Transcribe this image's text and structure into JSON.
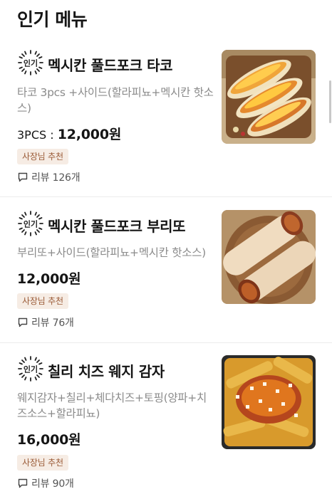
{
  "section": {
    "title": "인기 메뉴"
  },
  "popular_badge": {
    "label": "인기"
  },
  "items": [
    {
      "name": "멕시칸 풀드포크 타코",
      "description": "타코 3pcs +사이드(할라피뇨+멕시칸 핫소스)",
      "qty_label": "3PCS : ",
      "price": "12,000원",
      "owner_tag": "사장님 추천",
      "review": "리뷰 126개",
      "image_icon": "taco-photo"
    },
    {
      "name": "멕시칸 풀드포크 부리또",
      "description": "부리또+사이드(할라피뇨+멕시칸 핫소스)",
      "qty_label": "",
      "price": "12,000원",
      "owner_tag": "사장님 추천",
      "review": "리뷰 76개",
      "image_icon": "burrito-photo"
    },
    {
      "name": "칠리 치즈 웨지 감자",
      "description": "웨지감자+칠리+체다치즈+토핑(양파+치즈소스+할라피뇨)",
      "qty_label": "",
      "price": "16,000원",
      "owner_tag": "사장님 추천",
      "review": "리뷰 90개",
      "image_icon": "chili-cheese-fries-photo"
    }
  ],
  "colors": {
    "tag_bg": "#f6ece4",
    "tag_text": "#9a5a36",
    "desc_text": "#8b8b8b",
    "divider": "#ececec"
  }
}
